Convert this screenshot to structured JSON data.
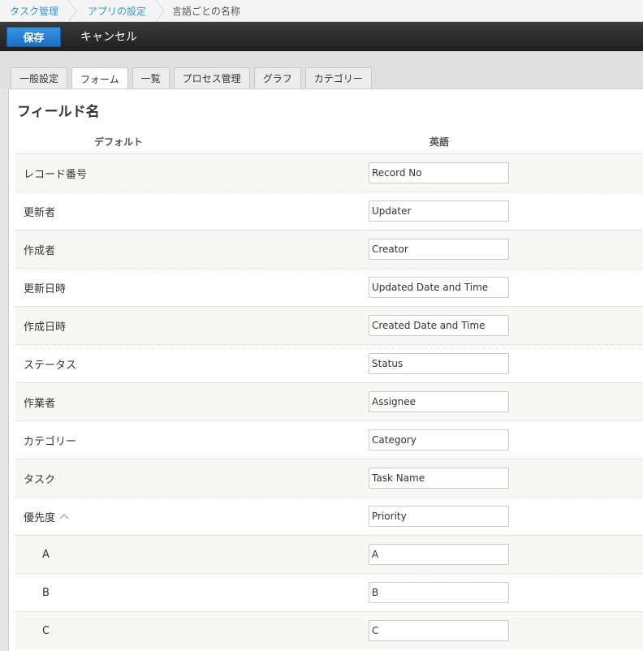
{
  "breadcrumb": {
    "items": [
      "タスク管理",
      "アプリの設定"
    ],
    "current": "言語ごとの名称"
  },
  "toolbar": {
    "save_label": "保存",
    "cancel_label": "キャンセル"
  },
  "tabs": [
    {
      "label": "一般設定"
    },
    {
      "label": "フォーム"
    },
    {
      "label": "一覧"
    },
    {
      "label": "プロセス管理"
    },
    {
      "label": "グラフ"
    },
    {
      "label": "カテゴリー"
    }
  ],
  "active_tab": "フォーム",
  "panel": {
    "title": "フィールド名",
    "col_default": "デフォルト",
    "col_english": "英語"
  },
  "rows": [
    {
      "label": "レコード番号",
      "value": "Record No"
    },
    {
      "label": "更新者",
      "value": "Updater"
    },
    {
      "label": "作成者",
      "value": "Creator"
    },
    {
      "label": "更新日時",
      "value": "Updated Date and Time"
    },
    {
      "label": "作成日時",
      "value": "Created Date and Time"
    },
    {
      "label": "ステータス",
      "value": "Status"
    },
    {
      "label": "作業者",
      "value": "Assignee"
    },
    {
      "label": "カテゴリー",
      "value": "Category"
    },
    {
      "label": "タスク",
      "value": "Task Name"
    },
    {
      "label": "優先度",
      "value": "Priority"
    },
    {
      "label": "A",
      "value": "A"
    },
    {
      "label": "B",
      "value": "B"
    },
    {
      "label": "C",
      "value": "C"
    }
  ],
  "colors": {
    "link": "#3498db",
    "save_button": "#1a6fc4",
    "toolbar": "#2b2b2b"
  }
}
